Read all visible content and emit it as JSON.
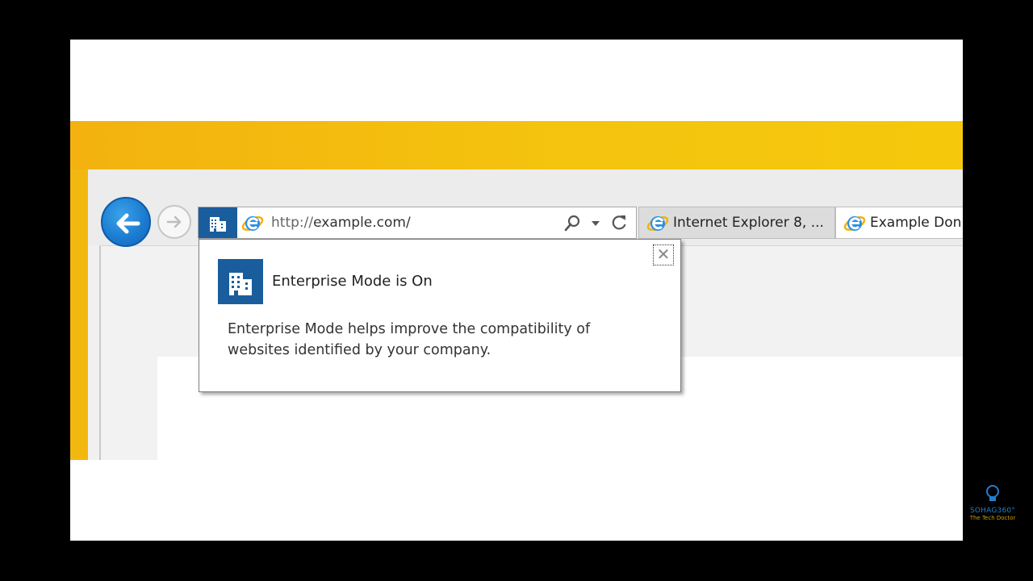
{
  "browser": {
    "address": {
      "url_prefix": "http://",
      "url_domain": "example.com/",
      "icons": [
        "enterprise-mode-icon",
        "ie-logo-icon",
        "search-icon",
        "dropdown-icon",
        "refresh-icon"
      ]
    },
    "tabs": [
      {
        "label": "Internet Explorer 8, ..."
      },
      {
        "label": "Example Don"
      }
    ],
    "nav": {
      "back_icon": "back-arrow-icon",
      "forward_icon": "forward-arrow-icon"
    }
  },
  "popup": {
    "title": "Enterprise Mode is On",
    "body": "Enterprise Mode helps improve the compatibility of websites identified by your company.",
    "close_glyph": "✕"
  },
  "watermark": {
    "name": "SOHAG360°",
    "tagline": "The Tech Doctor"
  },
  "colors": {
    "accent_blue": "#1a5d9c",
    "back_button": "#1a7ad0",
    "desktop_yellow": "#f2b80f"
  }
}
